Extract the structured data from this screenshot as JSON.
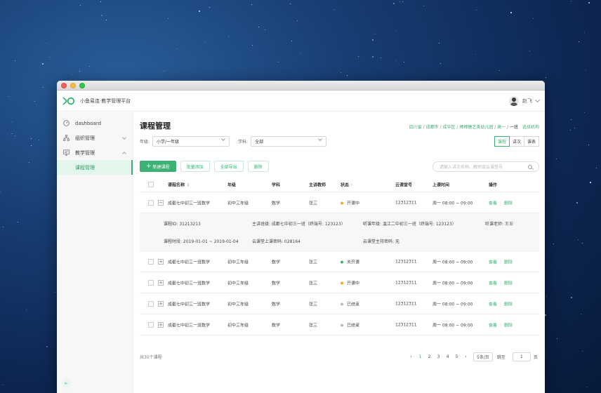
{
  "app": {
    "name": "小鱼易连·教学管理平台",
    "user_name": "赵飞"
  },
  "sidebar": {
    "items": [
      {
        "label": "dashboard",
        "icon": "gauge-icon"
      },
      {
        "label": "组织管理",
        "icon": "org-tree-icon"
      },
      {
        "label": "教学管理",
        "icon": "monitor-icon"
      },
      {
        "label": "课程管理"
      }
    ]
  },
  "page": {
    "title": "课程管理",
    "breadcrumb": [
      "四川省",
      "成都市",
      "成华区",
      "棒棒糖艺美幼儿园",
      "高一",
      "一班"
    ],
    "choose_org": "选择机构"
  },
  "filters": {
    "grade_label": "年级:",
    "grade_value": "小学/一年级",
    "subject_label": "学科:",
    "subject_value": "全部"
  },
  "view_tabs": [
    "课程",
    "讲次",
    "课表"
  ],
  "toolbar": {
    "new_course": "新建课程",
    "batch_add": "批量添加",
    "export_all": "全部导出",
    "delete": "删除"
  },
  "search": {
    "placeholder": "请输入讲次名称、教师或云课堂号"
  },
  "table": {
    "columns": [
      "课程名称",
      "年级",
      "学科",
      "主讲教师",
      "状态",
      "云课堂号",
      "上课时间",
      "操作"
    ],
    "rows": [
      {
        "name": "成都七中初三一班数学",
        "grade": "初中三年级",
        "subject": "数学",
        "teacher": "张三",
        "status": "开课中",
        "room": "12312311",
        "time": "周一 08:00 ~ 09:00",
        "view": "查看",
        "del": "删除",
        "expander": "−"
      },
      {
        "name": "成都七中初三一班数学",
        "grade": "初中三年级",
        "subject": "数学",
        "teacher": "张三",
        "status": "未开课",
        "room": "12312311",
        "time": "周一 08:00 ~ 09:00",
        "view": "查看",
        "del": "删除",
        "expander": "+"
      },
      {
        "name": "成都七中初三一班数学",
        "grade": "初中三年级",
        "subject": "数学",
        "teacher": "张三",
        "status": "开课中",
        "room": "12312311",
        "time": "周一 08:00 ~ 09:00",
        "view": "查看",
        "del": "删除",
        "expander": "+"
      },
      {
        "name": "成都七中初三一班数学",
        "grade": "初中三年级",
        "subject": "数学",
        "teacher": "张三",
        "status": "已结束",
        "room": "12312311",
        "time": "周一 08:00 ~ 09:00",
        "view": "查看",
        "del": "删除",
        "expander": "+"
      },
      {
        "name": "成都七中初三一班数学",
        "grade": "初中三年级",
        "subject": "数学",
        "teacher": "张三",
        "status": "已结束",
        "room": "12312311",
        "time": "周一 08:00 ~ 09:00",
        "view": "查看",
        "del": "删除",
        "expander": "+"
      }
    ],
    "detail": {
      "course_id": "课程ID:  31213213",
      "main_class": "主讲班级: 成都七中初三一班（终端号: 123123）",
      "listen_class": "听课年级: 温江二中初三一班（终端号: 123123）",
      "listen_teacher": "听课老师: 王五",
      "period": "课程时段:  2019-01-01 ~ 2019-01-04",
      "class_pwd": "云课堂上课密码: 028164",
      "host_pwd": "云课堂主持密码: 无"
    }
  },
  "pagination": {
    "total": "共30个课程",
    "prev": "‹",
    "pages": [
      "1",
      "2",
      "3",
      "4",
      "5"
    ],
    "next": "›",
    "page_size": "5条/页",
    "goto_label": "跳至",
    "goto_value": "1",
    "goto_suffix": "页"
  },
  "colors": {
    "accent": "#3bb273",
    "status_active": "#f5a623",
    "status_pending": "#3bb273",
    "status_ended": "#bbbbbb"
  }
}
